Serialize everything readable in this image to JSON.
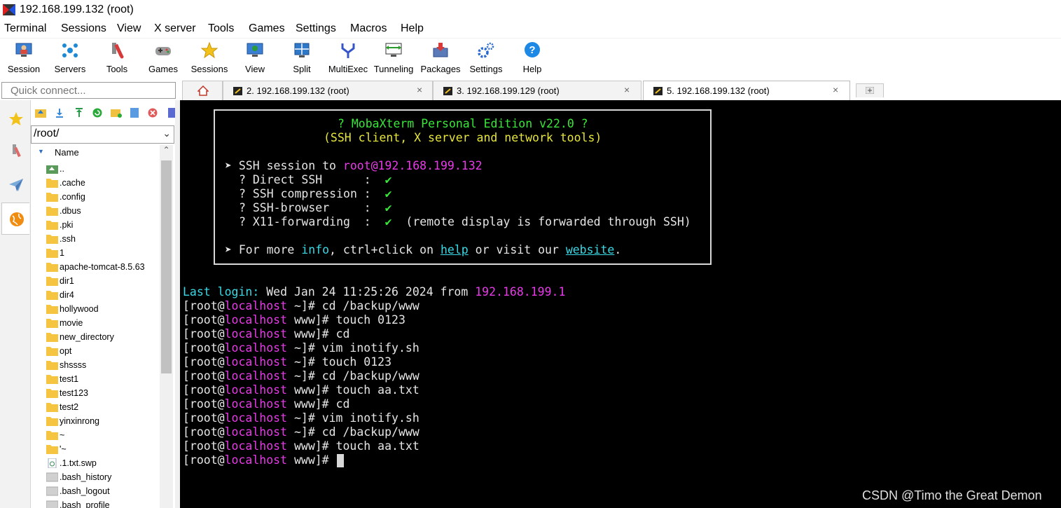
{
  "window": {
    "title": "192.168.199.132 (root)"
  },
  "menu": [
    "Terminal",
    "Sessions",
    "View",
    "X server",
    "Tools",
    "Games",
    "Settings",
    "Macros",
    "Help"
  ],
  "toolbar": [
    "Session",
    "Servers",
    "Tools",
    "Games",
    "Sessions",
    "View",
    "Split",
    "MultiExec",
    "Tunneling",
    "Packages",
    "Settings",
    "Help"
  ],
  "quick_connect": {
    "placeholder": "Quick connect..."
  },
  "tabs": [
    {
      "label": "2. 192.168.199.132 (root)",
      "close": "×"
    },
    {
      "label": "3. 192.168.199.129 (root)",
      "close": "×"
    },
    {
      "label": "5. 192.168.199.132 (root)",
      "close": "×"
    }
  ],
  "browser": {
    "path": "/root/",
    "column": "Name",
    "files": [
      "..",
      ".cache",
      ".config",
      ".dbus",
      ".pki",
      ".ssh",
      "1",
      "apache-tomcat-8.5.63",
      "dir1",
      "dir4",
      "hollywood",
      "movie",
      "new_directory",
      "opt",
      "shssss",
      "test1",
      "test123",
      "test2",
      "yinxinrong",
      "~",
      "'~",
      ".1.txt.swp",
      ".bash_history",
      ".bash_logout",
      ".bash_profile"
    ]
  },
  "terminal": {
    "banner": {
      "title": "? MobaXterm Personal Edition v22.0 ?",
      "subtitle": "(SSH client, X server and network tools)",
      "session_prefix": "➤ SSH session to ",
      "session_target": "root@192.168.199.132",
      "features": [
        {
          "label": "? Direct SSH      :  ",
          "check": "✔",
          "note": ""
        },
        {
          "label": "? SSH compression :  ",
          "check": "✔",
          "note": ""
        },
        {
          "label": "? SSH-browser     :  ",
          "check": "✔",
          "note": ""
        },
        {
          "label": "? X11-forwarding  :  ",
          "check": "✔",
          "note": "  (remote display is forwarded through SSH)"
        }
      ],
      "more": {
        "prefix": "➤ For more ",
        "info": "info",
        "mid": ", ctrl+click on ",
        "help": "help",
        "mid2": " or visit our ",
        "website": "website",
        "end": "."
      }
    },
    "last_login": {
      "label": "Last login:",
      "text": " Wed Jan 24 11:25:26 2024 from ",
      "ip": "192.168.199.1"
    },
    "prompt": {
      "user": "[root@",
      "host": "localhost"
    },
    "lines": [
      {
        "dir": " ~]# ",
        "cmd": "cd /backup/www"
      },
      {
        "dir": " www]# ",
        "cmd": "touch 0123"
      },
      {
        "dir": " www]# ",
        "cmd": "cd"
      },
      {
        "dir": " ~]# ",
        "cmd": "vim inotify.sh"
      },
      {
        "dir": " ~]# ",
        "cmd": "touch 0123"
      },
      {
        "dir": " ~]# ",
        "cmd": "cd /backup/www"
      },
      {
        "dir": " www]# ",
        "cmd": "touch aa.txt"
      },
      {
        "dir": " www]# ",
        "cmd": "cd"
      },
      {
        "dir": " ~]# ",
        "cmd": "vim inotify.sh"
      },
      {
        "dir": " ~]# ",
        "cmd": "cd /backup/www"
      },
      {
        "dir": " www]# ",
        "cmd": "touch aa.txt"
      },
      {
        "dir": " www]# ",
        "cmd": ""
      }
    ]
  },
  "watermark": "CSDN @Timo the Great Demon"
}
